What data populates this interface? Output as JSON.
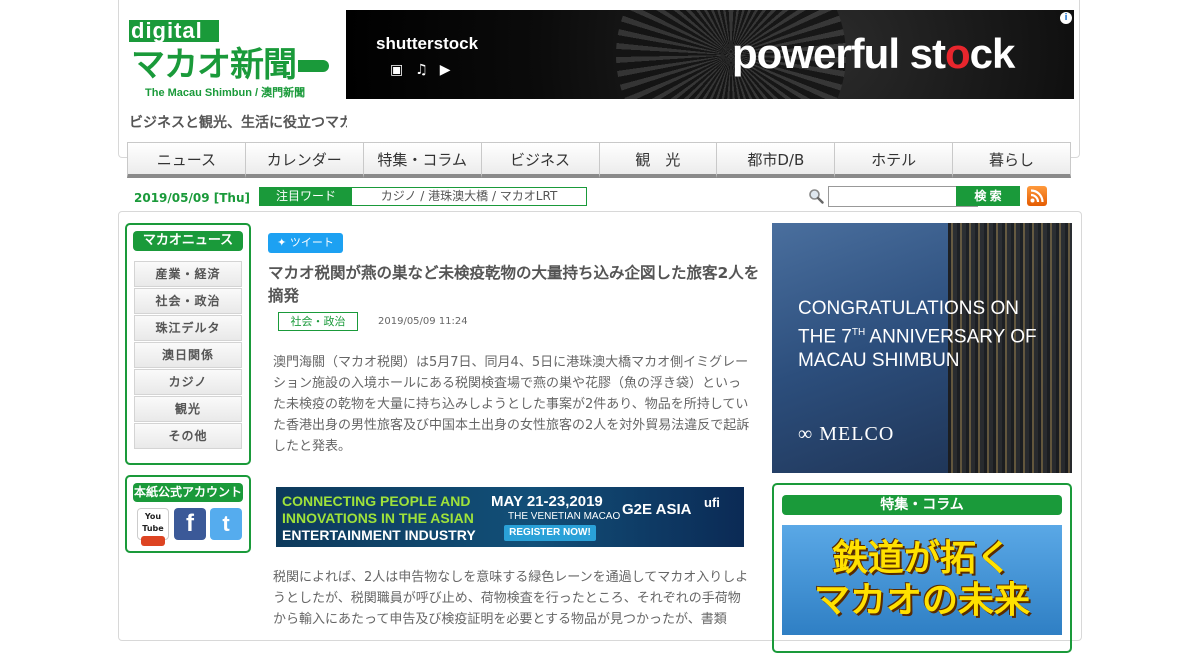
{
  "header": {
    "logo_digital": "digital",
    "logo_main": "マカオ新聞",
    "logo_sub": "The Macau Shimbun / 澳門新聞",
    "tagline": "ビジネスと観光、生活に役立つマカオ"
  },
  "top_ad": {
    "brand": "shutterstock",
    "slogan_a": "powerful st",
    "slogan_b": "ck",
    "info": "i"
  },
  "nav": {
    "items": [
      "ニュース",
      "カレンダー",
      "特集・コラム",
      "ビジネス",
      "観　光",
      "都市D/B",
      "ホテル",
      "暮らし"
    ]
  },
  "subbar": {
    "date": "2019/05/09 [Thu]",
    "hot_label": "注目ワード",
    "hot_words": "カジノ / 港珠澳大橋 / マカオLRT",
    "search_placeholder": "",
    "search_button": "検 索"
  },
  "sidebar": {
    "news_title": "マカオニュース",
    "categories": [
      "産業・経済",
      "社会・政治",
      "珠江デルタ",
      "澳日関係",
      "カジノ",
      "観光",
      "その他"
    ],
    "sns_title": "本紙公式アカウント",
    "sns": [
      "You Tube",
      "f",
      "t"
    ]
  },
  "article": {
    "tweet": "ツイート",
    "title": "マカオ税関が燕の巣など未検疫乾物の大量持ち込み企図した旅客2人を摘発",
    "category": "社会・政治",
    "date": "2019/05/09 11:24",
    "para1": "澳門海關（マカオ税関）は5月7日、同月4、5日に港珠澳大橋マカオ側イミグレーション施設の入境ホールにある税関検査場で燕の巣や花膠（魚の浮き袋）といった未検疫の乾物を大量に持ち込みしようとした事案が2件あり、物品を所持していた香港出身の男性旅客及び中国本土出身の女性旅客の2人を対外貿易法違反で起訴したと発表。",
    "para2": "税関によれば、2人は申告物なしを意味する緑色レーンを通過してマカオ入りしようとしたが、税関職員が呼び止め、荷物検査を行ったところ、それぞれの手荷物から輸入にあたって申告及び検疫証明を必要とする物品が見つかったが、書類"
  },
  "mid_ad": {
    "line1": "CONNECTING PEOPLE AND",
    "line2": "INNOVATIONS IN THE ASIAN",
    "line3": "ENTERTAINMENT INDUSTRY",
    "dates": "MAY 21-23,2019",
    "venue": "THE VENETIAN MACAO",
    "register": "REGISTER NOW!",
    "g2e": "G2E ASIA",
    "ufi": "ufi"
  },
  "right": {
    "ad_text_1": "CONGRATULATIONS ON",
    "ad_text_2a": "THE 7",
    "ad_text_2sup": "TH",
    "ad_text_2b": " ANNIVERSARY OF",
    "ad_text_3": "MACAU SHIMBUN",
    "ad_brand": "MELCO",
    "feature_title": "特集・コラム",
    "feature_line1": "鉄道が拓く",
    "feature_line2": "マカオの未来"
  }
}
